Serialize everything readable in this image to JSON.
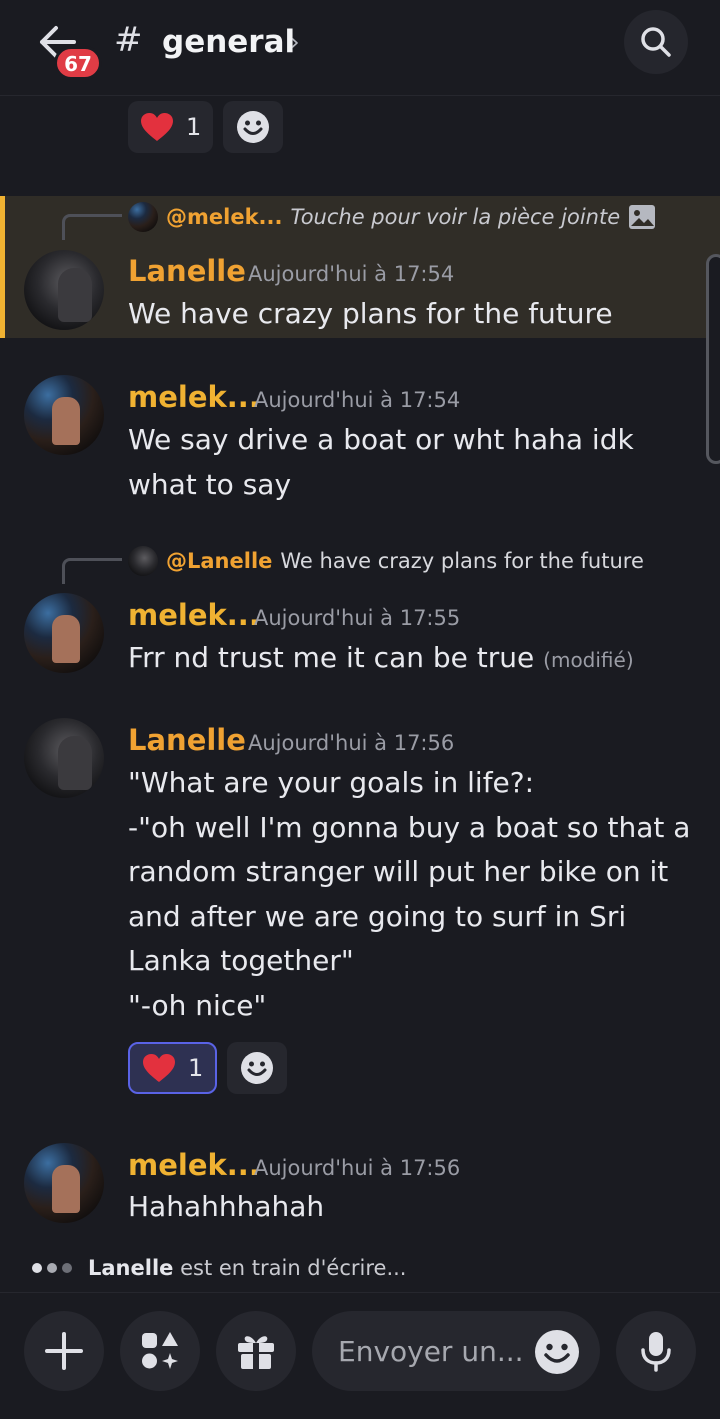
{
  "header": {
    "badge_count": "67",
    "hash": "#",
    "channel_name": "general",
    "chevron": "›"
  },
  "top_reactions": {
    "count": "1"
  },
  "messages": [
    {
      "reply": {
        "mention": "@melek...",
        "text": "Touche pour voir la pièce jointe"
      },
      "author": "Lanelle",
      "time": "Aujourd'hui à 17:54",
      "text": "We have crazy plans for the future"
    },
    {
      "author": "melek...",
      "time": "Aujourd'hui à 17:54",
      "text": "We say drive a boat or wht haha idk what to say"
    },
    {
      "reply": {
        "mention": "@Lanelle",
        "text": "We have crazy plans for the future"
      },
      "author": "melek...",
      "time": "Aujourd'hui à 17:55",
      "text": "Frr nd trust me it can be true",
      "edited": "(modifié)"
    },
    {
      "author": "Lanelle",
      "time": "Aujourd'hui à 17:56",
      "lines": [
        "\"What are your goals in life?:",
        "-\"oh well I'm gonna buy a boat so that a",
        "random stranger will put her bike on it",
        "and after we are going to surf in Sri",
        "Lanka together\"",
        "\"-oh nice\""
      ],
      "reaction_count": "1"
    },
    {
      "author": "melek...",
      "time": "Aujourd'hui à 17:56",
      "text": "Hahahhhahah"
    }
  ],
  "typing": {
    "user": "Lanelle",
    "text": "est en train d'écrire..."
  },
  "composer": {
    "placeholder": "Envoyer un..."
  },
  "colors": {
    "accent": "#5865f2",
    "highlight": "#f0b232",
    "badge": "#e03c45"
  }
}
